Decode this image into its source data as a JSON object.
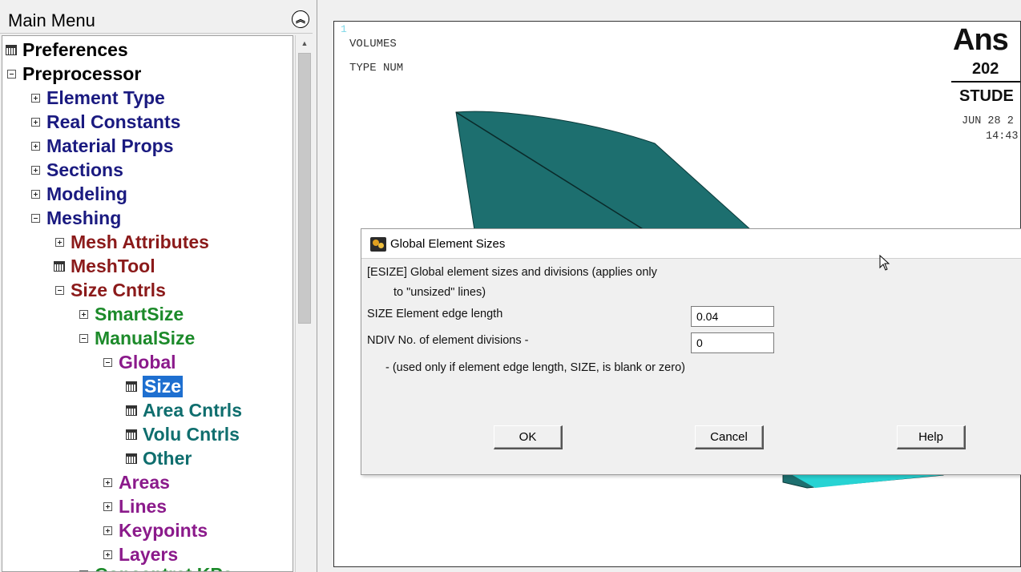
{
  "menu": {
    "title": "Main Menu",
    "collapse_icon": "double-chevron-up",
    "items": [
      {
        "label": "Preferences"
      },
      {
        "label": "Preprocessor"
      },
      {
        "label": "Element Type"
      },
      {
        "label": "Real Constants"
      },
      {
        "label": "Material Props"
      },
      {
        "label": "Sections"
      },
      {
        "label": "Modeling"
      },
      {
        "label": "Meshing"
      },
      {
        "label": "Mesh Attributes"
      },
      {
        "label": "MeshTool"
      },
      {
        "label": "Size Cntrls"
      },
      {
        "label": "SmartSize"
      },
      {
        "label": "ManualSize"
      },
      {
        "label": "Global"
      },
      {
        "label": "Size"
      },
      {
        "label": "Area Cntrls"
      },
      {
        "label": "Volu Cntrls"
      },
      {
        "label": "Other"
      },
      {
        "label": "Areas"
      },
      {
        "label": "Lines"
      },
      {
        "label": "Keypoints"
      },
      {
        "label": "Layers"
      },
      {
        "label": "Concentrat KPs"
      }
    ]
  },
  "graphics": {
    "window_number": "1",
    "label_volumes": "VOLUMES",
    "label_type": "TYPE NUM",
    "logo_text": "Ans",
    "year_text": "202",
    "edition_text": "STUDE",
    "date_text": "JUN 28 2",
    "time_text": "14:43",
    "volume_color": "#1d6f6f",
    "volume_bottom_color": "#27d3d3"
  },
  "dialog": {
    "title": "Global Element Sizes",
    "line1": "[ESIZE]  Global element sizes and divisions (applies only",
    "line2": "to \"unsized\" lines)",
    "size_label": "SIZE  Element edge length",
    "size_value": "0.04",
    "ndiv_label": "NDIV  No. of element divisions -",
    "ndiv_value": "0",
    "note": "- (used only if element edge length, SIZE, is blank or zero)",
    "ok_label": "OK",
    "cancel_label": "Cancel",
    "help_label": "Help"
  }
}
